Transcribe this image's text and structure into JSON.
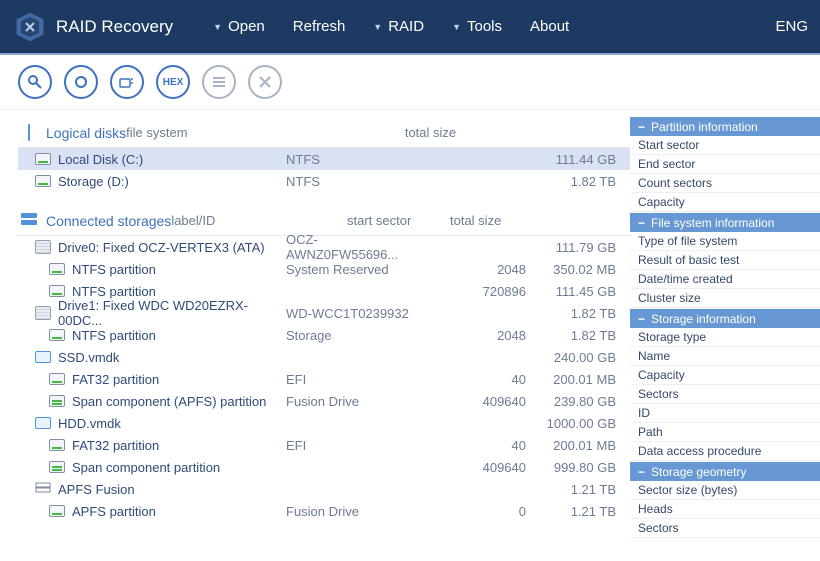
{
  "header": {
    "app_title": "RAID Recovery",
    "menu": {
      "open": "Open",
      "refresh": "Refresh",
      "raid": "RAID",
      "tools": "Tools",
      "about": "About"
    },
    "lang": "ENG"
  },
  "toolbar": {
    "hex_label": "HEX"
  },
  "sections": {
    "logical": {
      "title": "Logical disks",
      "cols": {
        "fs": "file system",
        "ts": "total size"
      },
      "rows": [
        {
          "name": "Local Disk (C:)",
          "fs": "NTFS",
          "ts": "111.44 GB",
          "selected": true
        },
        {
          "name": "Storage (D:)",
          "fs": "NTFS",
          "ts": "1.82 TB"
        }
      ]
    },
    "connected": {
      "title": "Connected storages",
      "cols": {
        "label": "label/ID",
        "ss": "start sector",
        "ts": "total size"
      },
      "items": [
        {
          "type": "drive",
          "name": "Drive0: Fixed OCZ-VERTEX3 (ATA)",
          "label": "OCZ-AWNZ0FW55696...",
          "ss": "",
          "ts": "111.79 GB"
        },
        {
          "type": "part",
          "name": "NTFS partition",
          "label": "System Reserved",
          "ss": "2048",
          "ts": "350.02 MB"
        },
        {
          "type": "part",
          "name": "NTFS partition",
          "label": "",
          "ss": "720896",
          "ts": "111.45 GB"
        },
        {
          "type": "drive",
          "name": "Drive1: Fixed WDC WD20EZRX-00DC...",
          "label": "WD-WCC1T0239932",
          "ss": "",
          "ts": "1.82 TB"
        },
        {
          "type": "part",
          "name": "NTFS partition",
          "label": "Storage",
          "ss": "2048",
          "ts": "1.82 TB"
        },
        {
          "type": "vmdk",
          "name": "SSD.vmdk",
          "label": "",
          "ss": "",
          "ts": "240.00 GB"
        },
        {
          "type": "part",
          "name": "FAT32 partition",
          "label": "EFI",
          "ss": "40",
          "ts": "200.01 MB"
        },
        {
          "type": "part2",
          "name": "Span component (APFS) partition",
          "label": "Fusion Drive",
          "ss": "409640",
          "ts": "239.80 GB"
        },
        {
          "type": "vmdk",
          "name": "HDD.vmdk",
          "label": "",
          "ss": "",
          "ts": "1000.00 GB"
        },
        {
          "type": "part",
          "name": "FAT32 partition",
          "label": "EFI",
          "ss": "40",
          "ts": "200.01 MB"
        },
        {
          "type": "part2",
          "name": "Span component partition",
          "label": "",
          "ss": "409640",
          "ts": "999.80 GB"
        },
        {
          "type": "raid",
          "name": "APFS Fusion",
          "label": "",
          "ss": "",
          "ts": "1.21 TB"
        },
        {
          "type": "part",
          "name": "APFS partition",
          "label": "Fusion Drive",
          "ss": "0",
          "ts": "1.21 TB"
        }
      ]
    }
  },
  "panels": [
    {
      "title": "Partition information",
      "items": [
        "Start sector",
        "End sector",
        "Count sectors",
        "Capacity"
      ]
    },
    {
      "title": "File system information",
      "items": [
        "Type of file system",
        "Result of basic test",
        "Date/time created",
        "Cluster size"
      ]
    },
    {
      "title": "Storage information",
      "items": [
        "Storage type",
        "Name",
        "Capacity",
        "Sectors",
        "ID",
        "Path",
        "Data access procedure"
      ]
    },
    {
      "title": "Storage geometry",
      "items": [
        "Sector size (bytes)",
        "Heads",
        "Sectors"
      ]
    }
  ]
}
